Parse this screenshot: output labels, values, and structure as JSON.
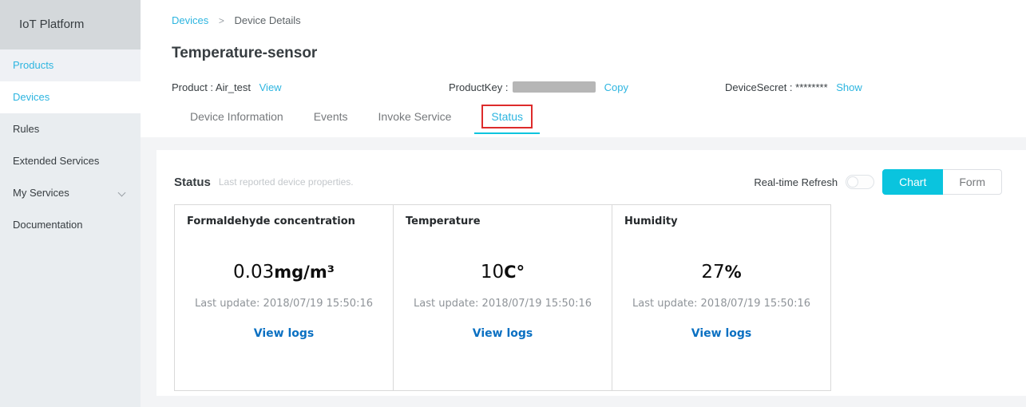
{
  "colors": {
    "accent": "#2db5e0",
    "chart-btn": "#0ac4de",
    "viewlogs": "#0a70c2",
    "annotation": "#dd2b2b"
  },
  "sidebar": {
    "title": "IoT Platform",
    "items": [
      {
        "label": "Products"
      },
      {
        "label": "Devices"
      },
      {
        "label": "Rules"
      },
      {
        "label": "Extended Services"
      },
      {
        "label": "My Services"
      },
      {
        "label": "Documentation"
      }
    ]
  },
  "breadcrumb": {
    "parent": "Devices",
    "separator": ">",
    "current": "Device Details"
  },
  "page": {
    "title": "Temperature-sensor"
  },
  "meta": {
    "product_label": "Product : ",
    "product_value": "Air_test",
    "view_link": "View",
    "productkey_label": "ProductKey : ",
    "copy_link": "Copy",
    "devicesecret_label": "DeviceSecret : ",
    "devicesecret_value": "********",
    "show_link": "Show"
  },
  "tabs": [
    {
      "label": "Device Information"
    },
    {
      "label": "Events"
    },
    {
      "label": "Invoke Service"
    },
    {
      "label": "Status"
    }
  ],
  "panel": {
    "heading": "Status",
    "subheading": "Last reported device properties.",
    "realtime_label": "Real-time Refresh",
    "toggle_state": "off",
    "buttons": [
      {
        "label": "Chart"
      },
      {
        "label": "Form"
      }
    ],
    "cards": [
      {
        "title": "Formaldehyde concentration",
        "value": "0.03",
        "unit": "mg/m³",
        "last_update_label": "Last update:",
        "last_update_time": "2018/07/19 15:50:16",
        "link": "View logs"
      },
      {
        "title": "Temperature",
        "value": "10",
        "unit": "C°",
        "last_update_label": "Last update:",
        "last_update_time": "2018/07/19 15:50:16",
        "link": "View logs"
      },
      {
        "title": "Humidity",
        "value": "27",
        "unit": "%",
        "last_update_label": "Last update:",
        "last_update_time": "2018/07/19 15:50:16",
        "link": "View logs"
      }
    ]
  }
}
